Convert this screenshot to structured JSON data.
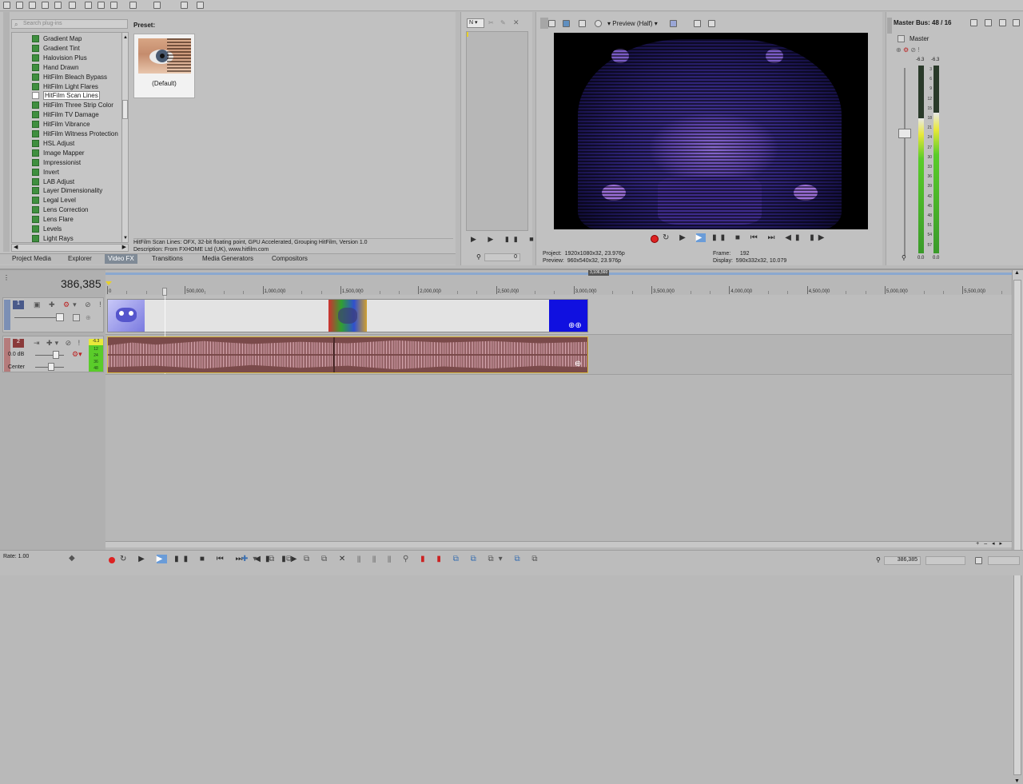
{
  "plugin_panel": {
    "search_placeholder": "Search plug-ins",
    "items": [
      {
        "label": "Gradient Map"
      },
      {
        "label": "Gradient Tint"
      },
      {
        "label": "Halovision Plus"
      },
      {
        "label": "Hand Drawn"
      },
      {
        "label": "HitFilm Bleach Bypass"
      },
      {
        "label": "HitFilm Light Flares"
      },
      {
        "label": "HitFilm Scan Lines",
        "selected": true
      },
      {
        "label": "HitFilm Three Strip Color"
      },
      {
        "label": "HitFilm TV Damage"
      },
      {
        "label": "HitFilm Vibrance"
      },
      {
        "label": "HitFilm Witness Protection"
      },
      {
        "label": "HSL Adjust"
      },
      {
        "label": "Image Mapper"
      },
      {
        "label": "Impressionist"
      },
      {
        "label": "Invert"
      },
      {
        "label": "LAB Adjust"
      },
      {
        "label": "Layer Dimensionality"
      },
      {
        "label": "Legal Level"
      },
      {
        "label": "Lens Correction"
      },
      {
        "label": "Lens Flare"
      },
      {
        "label": "Levels"
      },
      {
        "label": "Light Rays"
      }
    ]
  },
  "preset": {
    "heading": "Preset:",
    "default_label": "(Default)",
    "info_line1": "HitFilm Scan Lines: OFX, 32-bit floating point, GPU Accelerated, Grouping HitFilm, Version 1.0",
    "info_line2": "Description: From FXHOME Ltd (UK), www.hitfilm.com"
  },
  "tabs": [
    {
      "label": "Project Media",
      "active": false
    },
    {
      "label": "Explorer",
      "active": false
    },
    {
      "label": "Video FX",
      "active": true
    },
    {
      "label": "Transitions",
      "active": false
    },
    {
      "label": "Media Generators",
      "active": false
    },
    {
      "label": "Compositors",
      "active": false
    }
  ],
  "trimmer": {
    "dropdown": "N",
    "position": "0"
  },
  "preview": {
    "mode_label": "Preview (Half)",
    "project_label": "Project:",
    "project_value": "1920x1080x32, 23.976p",
    "preview_label": "Preview:",
    "preview_value": "960x540x32, 23.976p",
    "frame_label": "Frame:",
    "frame_value": "192",
    "display_label": "Display:",
    "display_value": "590x332x32, 10.079"
  },
  "master_bus": {
    "title": "Master Bus: 48 / 16",
    "label": "Master",
    "peak_left": "-6.3",
    "peak_right": "-6.3",
    "scale": [
      "3",
      "6",
      "9",
      "12",
      "15",
      "18",
      "21",
      "24",
      "27",
      "30",
      "33",
      "36",
      "39",
      "42",
      "45",
      "48",
      "51",
      "54",
      "57"
    ],
    "level_left": "0.0",
    "level_right": "0.0",
    "level_left_fill": 0.72,
    "level_right_fill": 0.75
  },
  "timeline": {
    "time_display": "386,385",
    "marker_label": "3,106,560",
    "ruler_labels": [
      "0",
      "500,000",
      "1,000,000",
      "1,500,000",
      "2,000,000",
      "2,500,000",
      "3,000,000",
      "3,500,000",
      "4,000,000",
      "4,500,000",
      "5,000,000",
      "5,500,000"
    ],
    "video_track_number": "1",
    "audio_track_number": "2",
    "audio_volume": "0.0 dB",
    "audio_pan": "Center",
    "audio_meter_peak": "-6.3",
    "audio_meter_scale": [
      "12",
      "24",
      "36",
      "48"
    ]
  },
  "status_bar": {
    "rate": "Rate: 1.00",
    "position": "386,385"
  },
  "colors": {
    "accent_selection": "#7f8a96",
    "audio_clip": "#7a4a4a",
    "audio_wave": "#e3b3bd",
    "meter_green": "#5acc2a",
    "meter_yellow": "#e8e83a",
    "video_blue": "#1010e0"
  }
}
